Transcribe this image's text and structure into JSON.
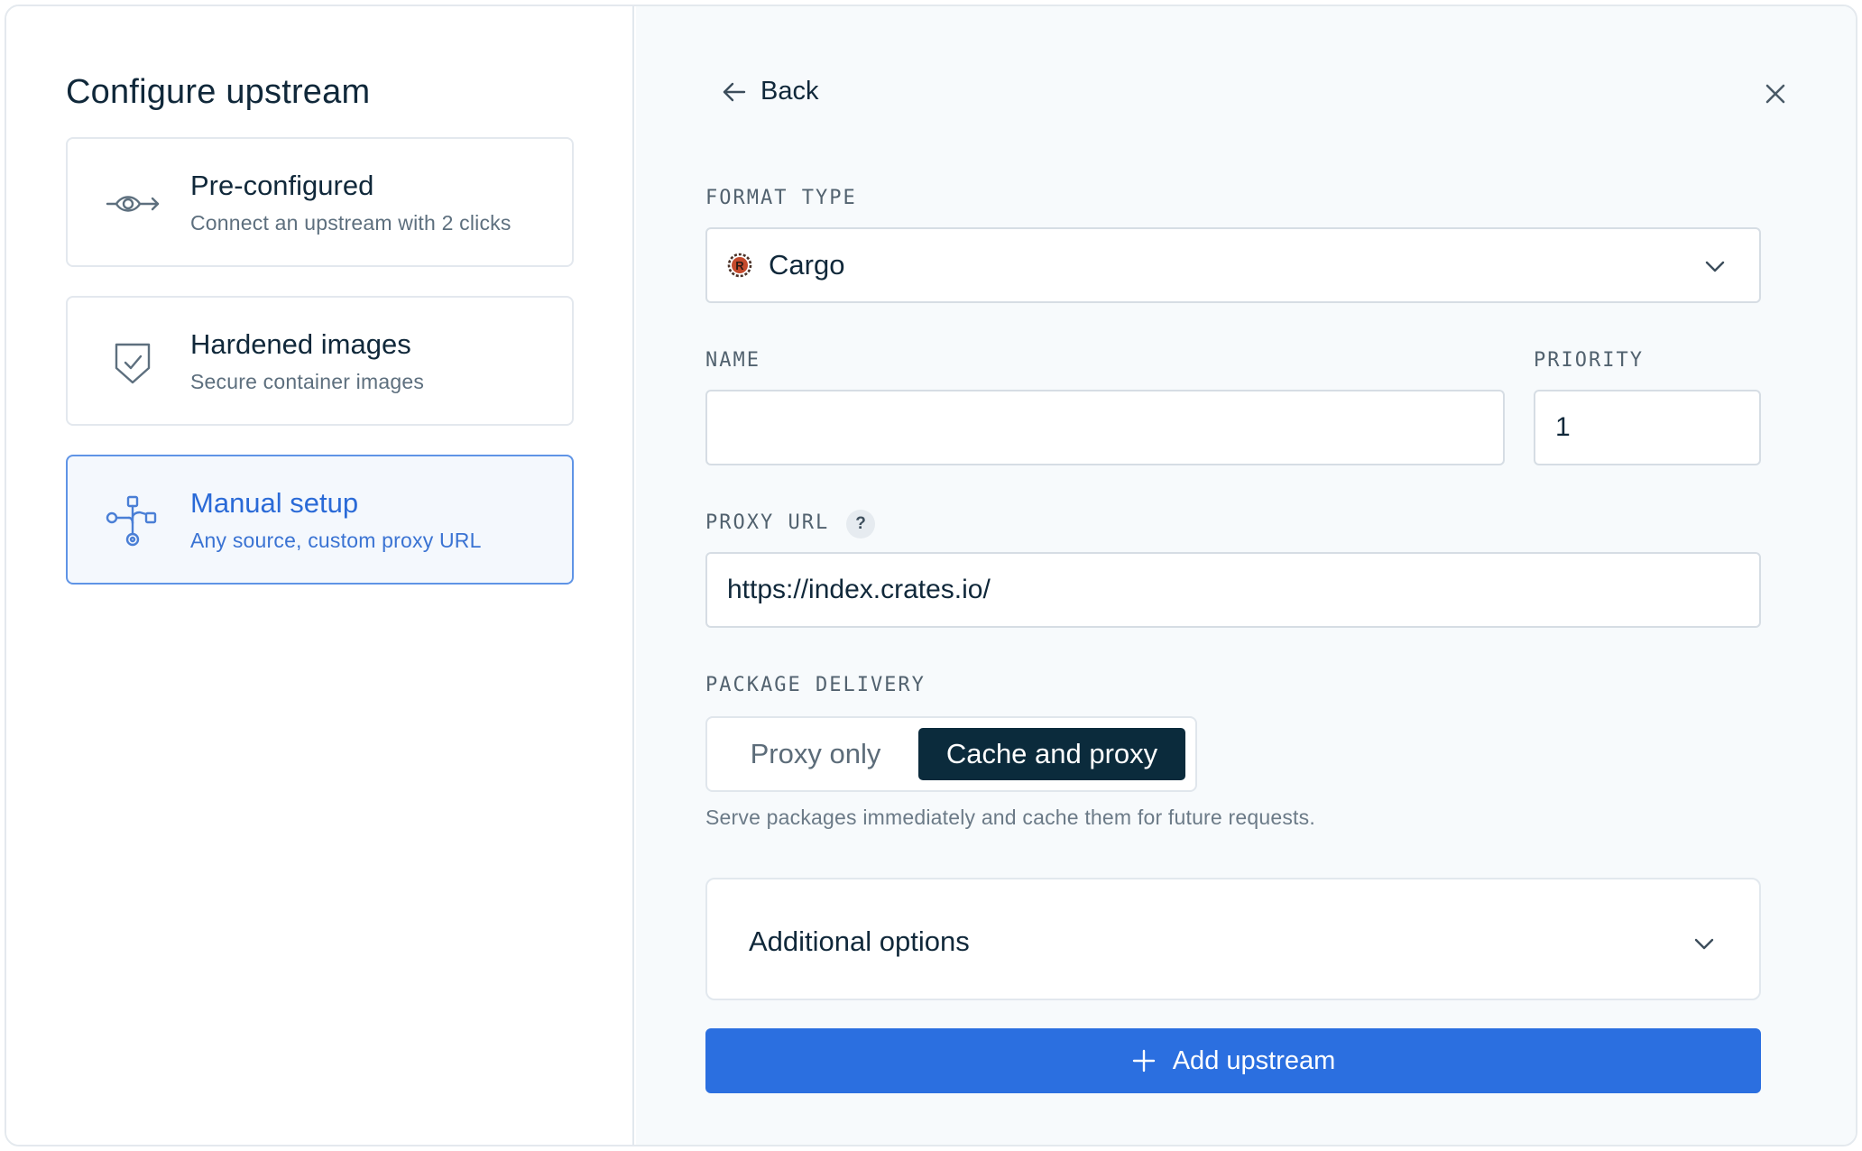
{
  "dialog": {
    "title": "Configure upstream"
  },
  "options": [
    {
      "title": "Pre-configured",
      "description": "Connect an upstream with 2 clicks",
      "icon": "eye-arrow-icon",
      "selected": false
    },
    {
      "title": "Hardened images",
      "description": "Secure container images",
      "icon": "shield-check-icon",
      "selected": false
    },
    {
      "title": "Manual setup",
      "description": "Any source, custom proxy URL",
      "icon": "network-nodes-icon",
      "selected": true
    }
  ],
  "header": {
    "back_label": "Back"
  },
  "format": {
    "label": "FORMAT TYPE",
    "value": "Cargo",
    "icon": "rust-logo-icon"
  },
  "name": {
    "label": "NAME",
    "value": "",
    "placeholder": ""
  },
  "priority": {
    "label": "PRIORITY",
    "value": "1"
  },
  "proxy_url": {
    "label": "PROXY URL",
    "help": "?",
    "value": "https://index.crates.io/"
  },
  "delivery": {
    "label": "PACKAGE DELIVERY",
    "options": [
      "Proxy only",
      "Cache and proxy"
    ],
    "selected": "Cache and proxy",
    "helper": "Serve packages immediately and cache them for future requests."
  },
  "additional_options": {
    "label": "Additional options"
  },
  "submit": {
    "label": "Add upstream"
  },
  "colors": {
    "accent": "#2b6fe0",
    "dark": "#0b2b3c",
    "selected_border": "#5f94e6"
  }
}
